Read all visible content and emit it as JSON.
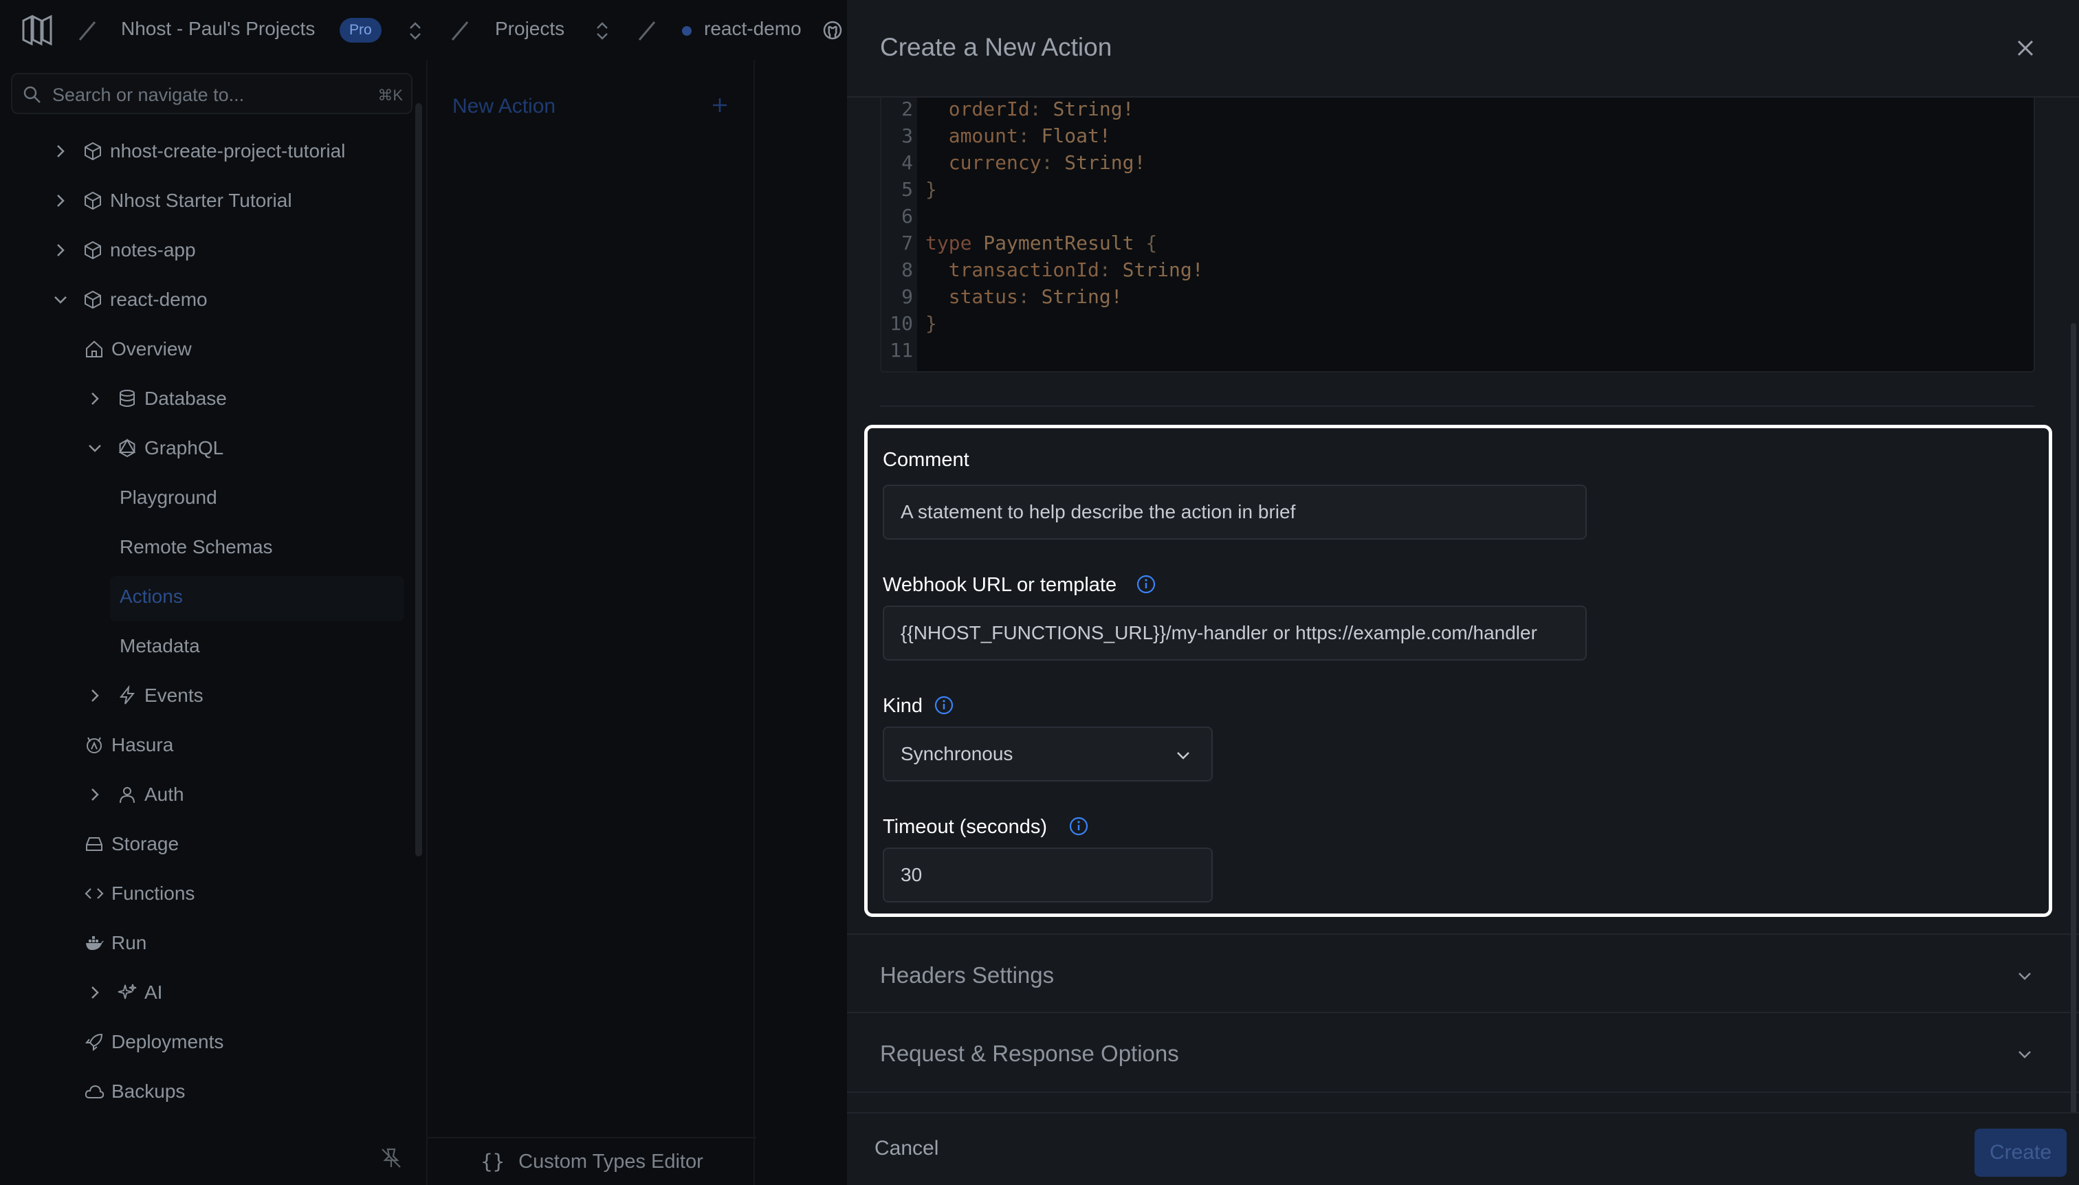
{
  "topbar": {
    "org": "Nhost - Paul's Projects",
    "plan_badge": "Pro",
    "projects": "Projects",
    "project": "react-demo"
  },
  "sidebar": {
    "search_placeholder": "Search or navigate to...",
    "search_shortcut": "⌘K",
    "items": [
      {
        "label": "nhost-create-project-tutorial"
      },
      {
        "label": "Nhost Starter Tutorial"
      },
      {
        "label": "notes-app"
      },
      {
        "label": "react-demo"
      },
      {
        "label": "Overview"
      },
      {
        "label": "Database"
      },
      {
        "label": "GraphQL"
      },
      {
        "label": "Playground"
      },
      {
        "label": "Remote Schemas"
      },
      {
        "label": "Actions"
      },
      {
        "label": "Metadata"
      },
      {
        "label": "Events"
      },
      {
        "label": "Hasura"
      },
      {
        "label": "Auth"
      },
      {
        "label": "Storage"
      },
      {
        "label": "Functions"
      },
      {
        "label": "Run"
      },
      {
        "label": "AI"
      },
      {
        "label": "Deployments"
      },
      {
        "label": "Backups"
      }
    ]
  },
  "middle": {
    "new_action": "New Action",
    "custom_types_editor": "Custom Types Editor",
    "braces": "{}"
  },
  "drawer": {
    "title": "Create a New Action",
    "code_lines": [
      {
        "n": "2",
        "text": "  orderId: String!"
      },
      {
        "n": "3",
        "text": "  amount: Float!"
      },
      {
        "n": "4",
        "text": "  currency: String!"
      },
      {
        "n": "5",
        "text": "}"
      },
      {
        "n": "6",
        "text": ""
      },
      {
        "n": "7",
        "text": "type PaymentResult {"
      },
      {
        "n": "8",
        "text": "  transactionId: String!"
      },
      {
        "n": "9",
        "text": "  status: String!"
      },
      {
        "n": "10",
        "text": "}"
      },
      {
        "n": "11",
        "text": ""
      }
    ],
    "comment_label": "Comment",
    "comment_placeholder": "A statement to help describe the action in brief",
    "webhook_label": "Webhook URL or template",
    "webhook_placeholder": "{{NHOST_FUNCTIONS_URL}}/my-handler or https://example.com/handler",
    "kind_label": "Kind",
    "kind_value": "Synchronous",
    "timeout_label": "Timeout (seconds)",
    "timeout_value": "30",
    "headers_settings": "Headers Settings",
    "request_response_options": "Request & Response Options",
    "cancel": "Cancel",
    "create": "Create"
  },
  "colors": {
    "accent_blue": "#3b82f6",
    "drawer_bg": "#16191e",
    "page_bg": "#0b0d10"
  }
}
